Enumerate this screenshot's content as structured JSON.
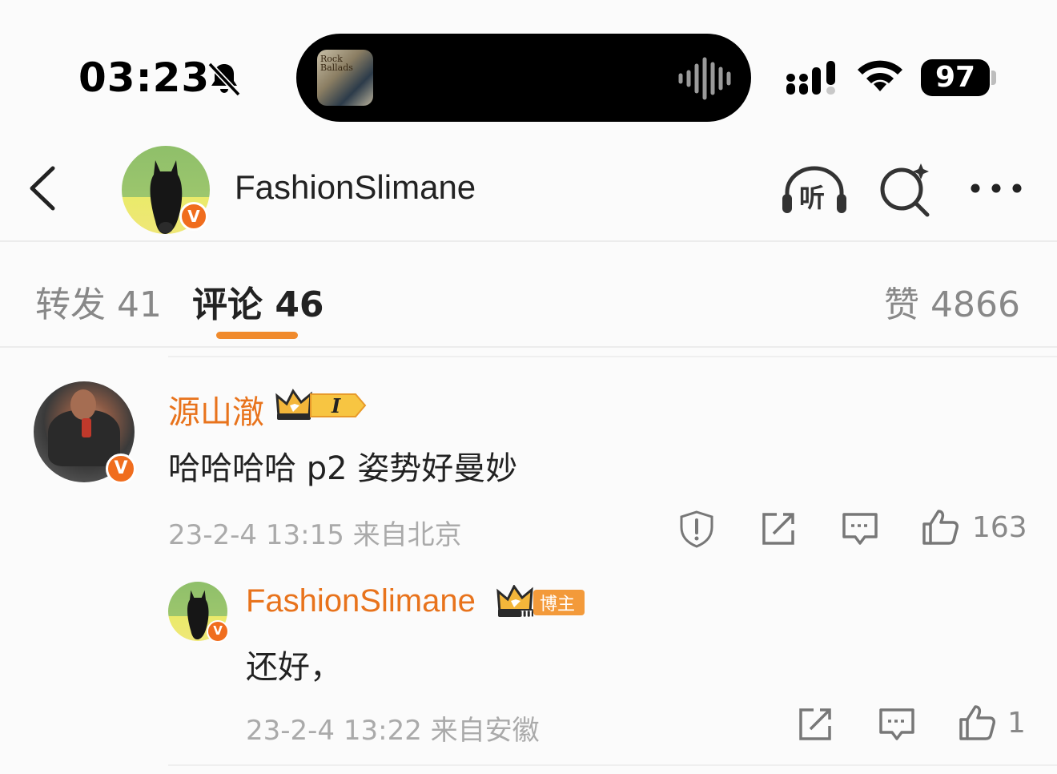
{
  "status_bar": {
    "time": "03:23",
    "battery": "97",
    "album_art_text": "Rock Ballads"
  },
  "header": {
    "title": "FashionSlimane",
    "listen_label": "听"
  },
  "tabs": {
    "repost": "转发 41",
    "comment": "评论 46",
    "like": "赞 4866"
  },
  "comments": [
    {
      "name": "源山澈",
      "text": "哈哈哈哈 p2 姿势好曼妙",
      "meta": "23-2-4 13:15  来自北京",
      "likes": "163",
      "badge_level": "I"
    },
    {
      "name": "FashionSlimane",
      "text": "还好，",
      "meta": "23-2-4 13:22  来自安徽",
      "likes": "1",
      "badge_level": "III",
      "badge_label": "博主"
    }
  ],
  "colors": {
    "accent": "#f08a2c",
    "name": "#e8731c",
    "verified": "#f06d1e"
  },
  "icons": [
    "bell-slash-icon",
    "waveform-icon",
    "signal-icon",
    "wifi-icon",
    "back-icon",
    "listen-icon",
    "search-icon",
    "more-icon",
    "report-icon",
    "share-icon",
    "comment-icon",
    "like-icon"
  ]
}
